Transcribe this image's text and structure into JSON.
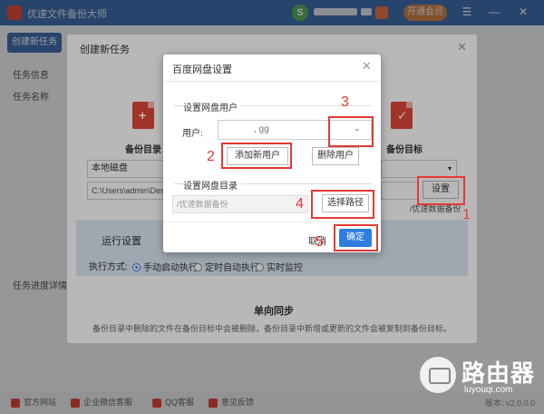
{
  "app": {
    "title": "优速文件备份大师",
    "vip_label": "开通会员",
    "new_task_label": "创建新任务",
    "task_info_label": "任务信息",
    "task_name_label": "任务名称",
    "task_progress_label": "任务进度详情"
  },
  "task_window": {
    "title": "创建新任务",
    "source_label": "备份目录",
    "target_label": "备份目标",
    "source_type": "本地磁盘",
    "source_path": "C:\\Users\\admin\\Desk",
    "target_path": "/优速数据备份",
    "settings_btn": "设置",
    "run_settings": "运行设置",
    "run_mode_label": "执行方式:",
    "run_modes": [
      "手动启动执行",
      "定时自动执行",
      "实时监控"
    ],
    "sync_title": "单向同步",
    "sync_desc": "备份目录中删除的文件在备份目标中会被删除，备份目录中新增或更新的文件会被复制到备份目标。"
  },
  "dialog": {
    "title": "百度网盘设置",
    "user_section": "设置网盘用户",
    "user_label": "用户:",
    "user_value": ", gg",
    "add_user": "添加新用户",
    "delete_user": "删除用户",
    "dir_section": "设置网盘目录",
    "dir_placeholder": "/优速数据备份",
    "choose_path": "选择路径",
    "cancel": "取消",
    "ok": "确定"
  },
  "annotations": [
    "1",
    "2",
    "3",
    "4",
    "5"
  ],
  "footer": {
    "items": [
      "官方网站",
      "企业微信客服",
      "QQ客服",
      "意见反馈"
    ],
    "version": "版本: v2.0.0.0"
  },
  "watermark": {
    "title": "路由器",
    "url": "luyouqi.com"
  },
  "colors": {
    "titlebar": "#3f6fb0",
    "accent": "#2f7de1",
    "annotation": "#e53935",
    "doc_icon": "#e0483a"
  }
}
